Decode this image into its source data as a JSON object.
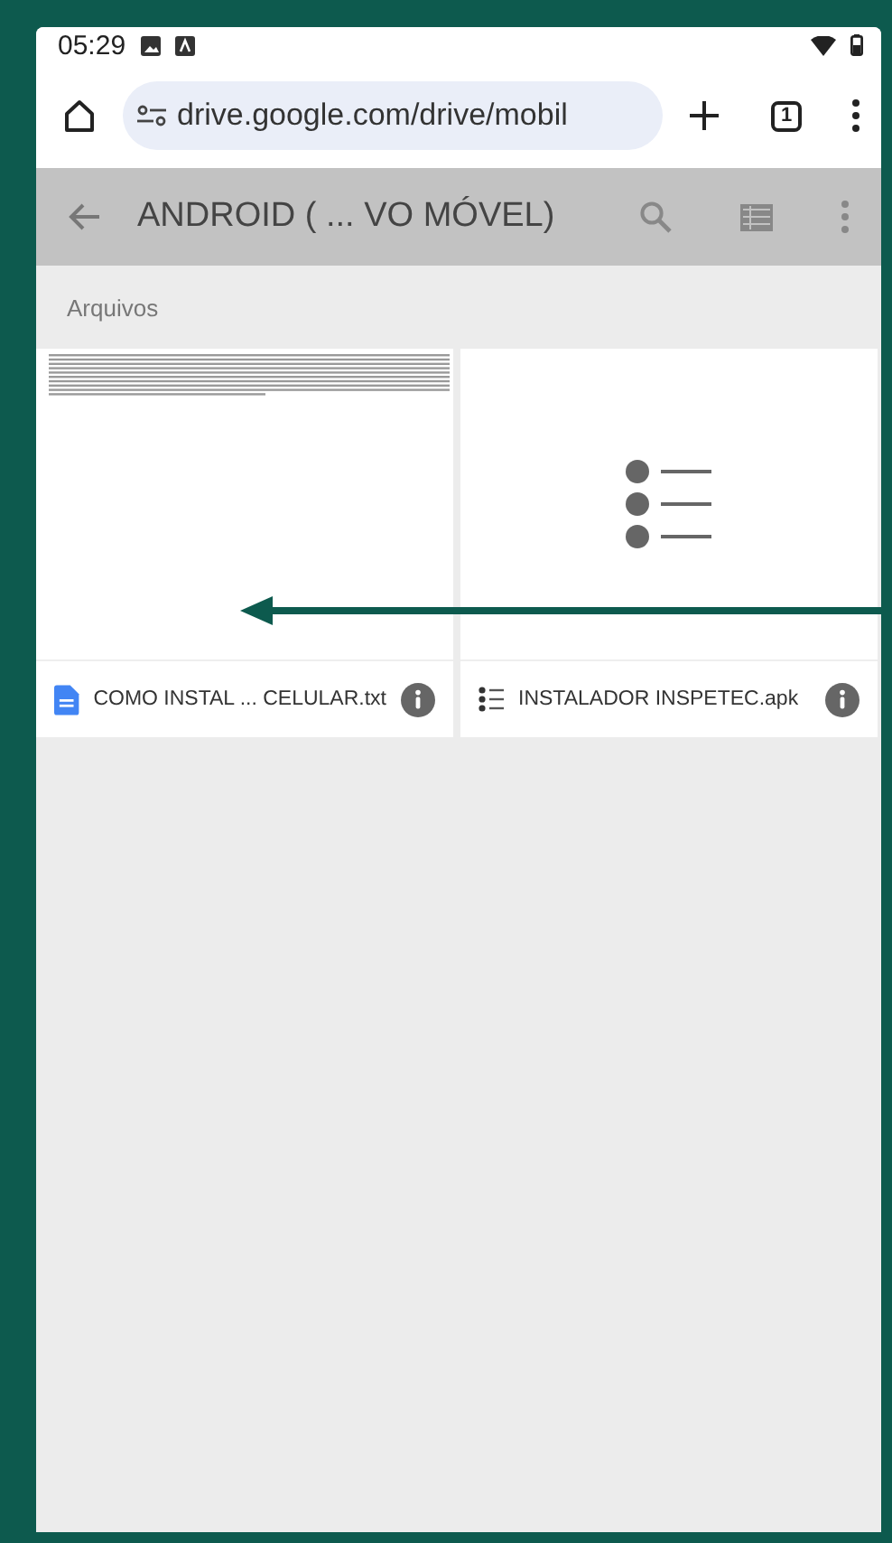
{
  "status_bar": {
    "time": "05:29"
  },
  "browser": {
    "url": "drive.google.com/drive/mobil",
    "tab_count": "1"
  },
  "header": {
    "title": "ANDROID ( ... VO MÓVEL)"
  },
  "section": {
    "title": "Arquivos"
  },
  "files": [
    {
      "name": "COMO INSTAL ... CELULAR.txt",
      "kind": "doc"
    },
    {
      "name": "INSTALADOR INSPETEC.apk",
      "kind": "apk"
    }
  ]
}
